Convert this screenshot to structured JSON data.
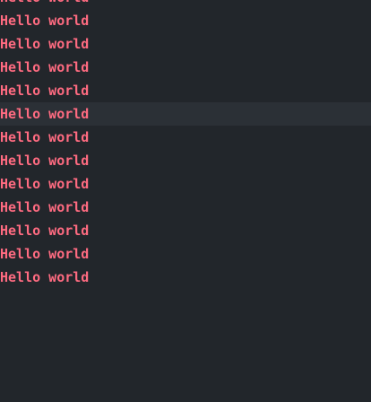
{
  "editor": {
    "current_line_index": 5,
    "text_color": "#ff6b81",
    "background_color": "#22262b",
    "current_line_color": "#2b3036",
    "lines": [
      "Hello world",
      "Hello world",
      "Hello world",
      "Hello world",
      "Hello world",
      "Hello world",
      "Hello world",
      "Hello world",
      "Hello world",
      "Hello world",
      "Hello world",
      "Hello world",
      "Hello world"
    ]
  }
}
